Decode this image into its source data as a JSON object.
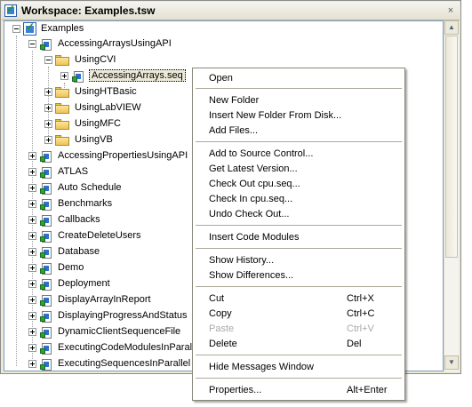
{
  "window": {
    "title": "Workspace: Examples.tsw",
    "close_glyph": "×"
  },
  "tree": {
    "root": "Examples",
    "items": [
      "AccessingArraysUsingAPI",
      "UsingCVI",
      "AccessingArrays.seq",
      "UsingHTBasic",
      "UsingLabVIEW",
      "UsingMFC",
      "UsingVB",
      "AccessingPropertiesUsingAPI",
      "ATLAS",
      "Auto Schedule",
      "Benchmarks",
      "Callbacks",
      "CreateDeleteUsers",
      "Database",
      "Demo",
      "Deployment",
      "DisplayArrayInReport",
      "DisplayingProgressAndStatus",
      "DynamicClientSequenceFile",
      "ExecutingCodeModulesInParallel",
      "ExecutingSequencesInParallel"
    ]
  },
  "menu": {
    "items": [
      {
        "label": "Open",
        "shortcut": ""
      },
      {
        "label": "New Folder",
        "shortcut": ""
      },
      {
        "label": "Insert New Folder From Disk...",
        "shortcut": ""
      },
      {
        "label": "Add Files...",
        "shortcut": ""
      },
      {
        "label": "Add to Source Control...",
        "shortcut": ""
      },
      {
        "label": "Get Latest Version...",
        "shortcut": ""
      },
      {
        "label": "Check Out cpu.seq...",
        "shortcut": ""
      },
      {
        "label": "Check In cpu.seq...",
        "shortcut": ""
      },
      {
        "label": "Undo Check Out...",
        "shortcut": ""
      },
      {
        "label": "Insert Code Modules",
        "shortcut": ""
      },
      {
        "label": "Show History...",
        "shortcut": ""
      },
      {
        "label": "Show Differences...",
        "shortcut": ""
      },
      {
        "label": "Cut",
        "shortcut": "Ctrl+X"
      },
      {
        "label": "Copy",
        "shortcut": "Ctrl+C"
      },
      {
        "label": "Paste",
        "shortcut": "Ctrl+V",
        "disabled": true
      },
      {
        "label": "Delete",
        "shortcut": "Del"
      },
      {
        "label": "Hide Messages Window",
        "shortcut": ""
      },
      {
        "label": "Properties...",
        "shortcut": "Alt+Enter"
      }
    ]
  },
  "icons": {
    "workspace": "workspace-icon",
    "project": "project-icon",
    "folder": "folder-icon",
    "sequence": "sequence-file-icon",
    "expand": "expand-icon",
    "collapse": "collapse-icon",
    "scroll_up": "scroll-up-icon",
    "scroll_down": "scroll-down-icon"
  },
  "scrollbar": {
    "up_glyph": "▲",
    "down_glyph": "▼"
  }
}
